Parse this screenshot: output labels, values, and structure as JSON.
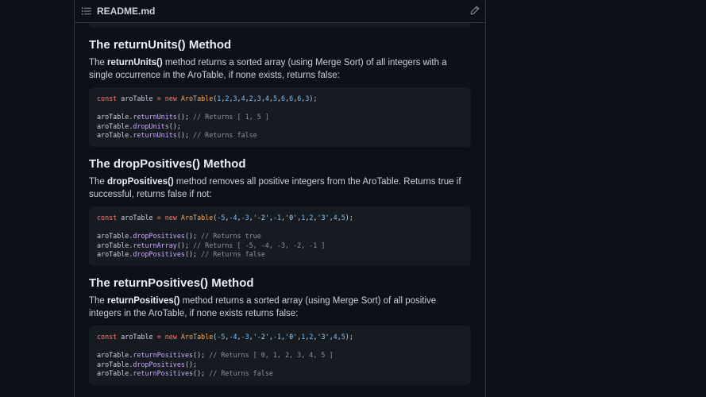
{
  "file_header": {
    "filename": "README.md",
    "list_icon": "list-icon",
    "edit_icon": "pencil-icon"
  },
  "sections": [
    {
      "heading": "The returnUnits() Method",
      "intro_the": "The ",
      "method_bold": "returnUnits()",
      "description_rest": " method returns a sorted array (using Merge Sort) of all integers with a single occurrence in the AroTable, if none exists, returns false:",
      "code": {
        "decl": {
          "kw": "const",
          "name": " aroTable ",
          "op": "=",
          "kw2": " new ",
          "cls": "AroTable",
          "args": "(1,2,3,4,2,3,4,5,6,6,6,3);"
        },
        "calls": [
          {
            "obj": "aroTable.",
            "fn": "returnUnits",
            "rest": "(); ",
            "comment": "// Returns [ 1, 5 ]"
          },
          {
            "obj": "aroTable.",
            "fn": "dropUnits",
            "rest": "();",
            "comment": ""
          },
          {
            "obj": "aroTable.",
            "fn": "returnUnits",
            "rest": "(); ",
            "comment": "// Returns false"
          }
        ]
      }
    },
    {
      "heading": "The dropPositives() Method",
      "intro_the": "The ",
      "method_bold": "dropPositives()",
      "description_rest": " method removes all positive integers from the AroTable. Returns true if successful, returns false if not:",
      "code": {
        "decl": {
          "kw": "const",
          "name": " aroTable ",
          "op": "=",
          "kw2": " new ",
          "cls": "AroTable",
          "args": "(-5,-4,-3,'-2',-1,'0',1,2,'3',4,5);"
        },
        "calls": [
          {
            "obj": "aroTable.",
            "fn": "dropPositives",
            "rest": "(); ",
            "comment": "// Returns true"
          },
          {
            "obj": "aroTable.",
            "fn": "returnArray",
            "rest": "(); ",
            "comment": "// Returns [ -5, -4, -3, -2, -1 ]"
          },
          {
            "obj": "aroTable.",
            "fn": "dropPositives",
            "rest": "(); ",
            "comment": "// Returns false"
          }
        ]
      }
    },
    {
      "heading": "The returnPositives() Method",
      "intro_the": "The ",
      "method_bold": "returnPositives()",
      "description_rest": " method returns a sorted array (using Merge Sort) of all positive integers in the AroTable, if none exists returns false:",
      "code": {
        "decl": {
          "kw": "const",
          "name": " aroTable ",
          "op": "=",
          "kw2": " new ",
          "cls": "AroTable",
          "args": "(-5,-4,-3,'-2',-1,'0',1,2,'3',4,5);"
        },
        "calls": [
          {
            "obj": "aroTable.",
            "fn": "returnPositives",
            "rest": "(); ",
            "comment": "// Returns [ 0, 1, 2, 3, 4, 5 ]"
          },
          {
            "obj": "aroTable.",
            "fn": "dropPositives",
            "rest": "();",
            "comment": ""
          },
          {
            "obj": "aroTable.",
            "fn": "returnPositives",
            "rest": "(); ",
            "comment": "// Returns false"
          }
        ]
      }
    }
  ]
}
